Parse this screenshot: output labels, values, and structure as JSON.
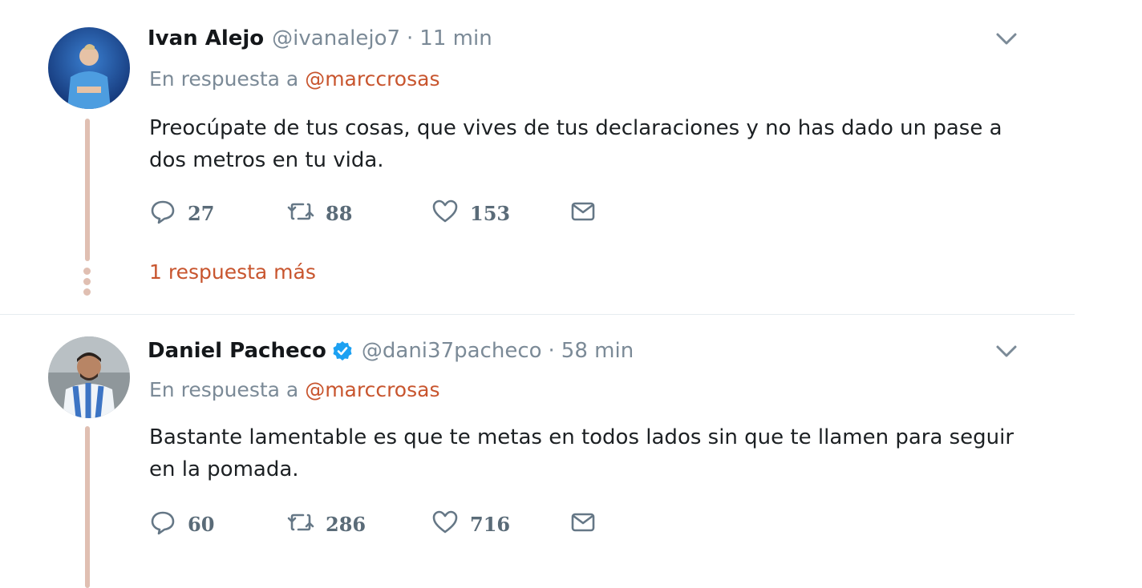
{
  "tweets": [
    {
      "name": "Ivan Alejo",
      "verified": false,
      "handle": "@ivanalejo7",
      "separator": "·",
      "time": "11 min",
      "reply_prefix": "En respuesta a",
      "reply_mention": "@marccrosas",
      "text": "Preocúpate de tus cosas, que vives de tus declaraciones y no has dado un pase a dos metros en tu vida.",
      "replies": "27",
      "retweets": "88",
      "likes": "153",
      "more_replies": "1 respuesta más"
    },
    {
      "name": "Daniel Pacheco",
      "verified": true,
      "handle": "@dani37pacheco",
      "separator": "·",
      "time": "58 min",
      "reply_prefix": "En respuesta a",
      "reply_mention": "@marccrosas",
      "text": "Bastante lamentable es que te metas en todos lados sin que te llamen para seguir en la pomada.",
      "replies": "60",
      "retweets": "286",
      "likes": "716"
    }
  ],
  "icons": {
    "reply": "speech-bubble-icon",
    "retweet": "retweet-arrows-icon",
    "like": "heart-icon",
    "dm": "envelope-icon",
    "menu": "chevron-down-icon",
    "verified": "verified-badge-icon"
  },
  "colors": {
    "accent": "#c8552e",
    "thread_line": "#e0bfb2",
    "muted": "#7b8a97",
    "verified": "#1da1f2"
  }
}
